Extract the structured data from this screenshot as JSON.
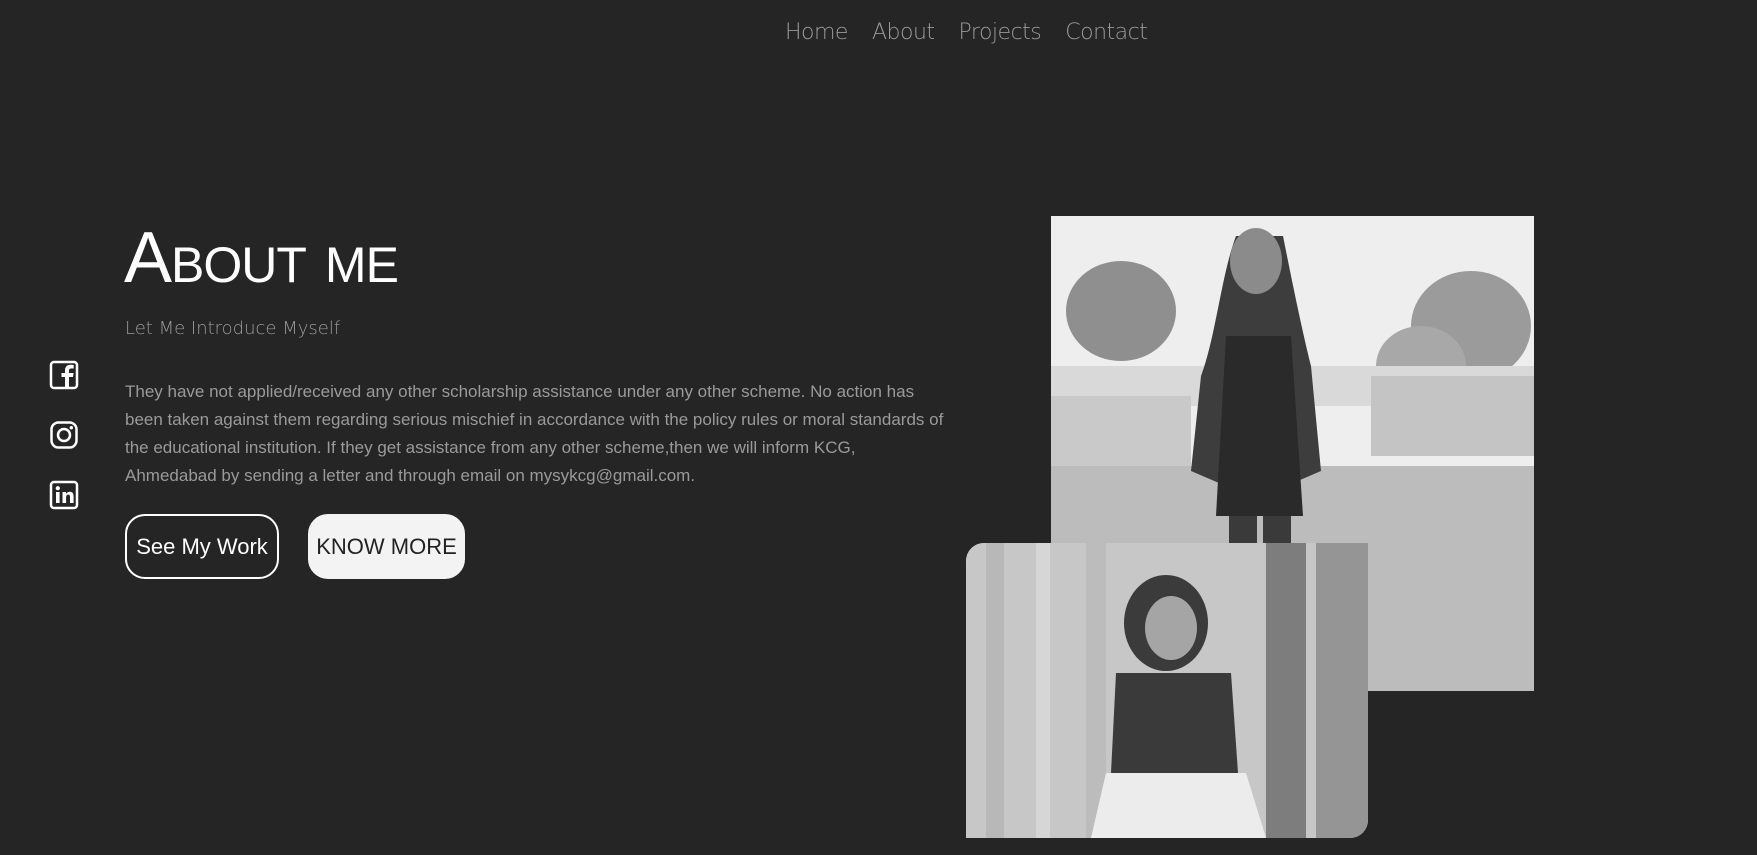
{
  "nav": {
    "items": [
      {
        "label": "Home"
      },
      {
        "label": "About"
      },
      {
        "label": "Projects"
      },
      {
        "label": "Contact"
      }
    ]
  },
  "socials": {
    "items": [
      {
        "icon": "facebook-icon"
      },
      {
        "icon": "instagram-icon"
      },
      {
        "icon": "linkedin-icon"
      }
    ]
  },
  "about": {
    "title": "About me",
    "subtitle": "Let Me Introduce Myself",
    "paragraph": "They have not applied/received any other scholarship assistance under any other scheme. No action has been taken against them regarding serious mischief in accordance with the policy rules or moral standards of the educational institution. If they get assistance from any other scheme,then we will inform KCG, Ahmedabad by sending a letter and through email on mysykcg@gmail.com.",
    "buttons": {
      "primary": "See My Work",
      "secondary": "KNOW MORE"
    }
  },
  "colors": {
    "background": "#252525",
    "text_primary": "#ffffff",
    "text_muted": "#9a9a9a",
    "button_solid": "#f3f3f3"
  }
}
